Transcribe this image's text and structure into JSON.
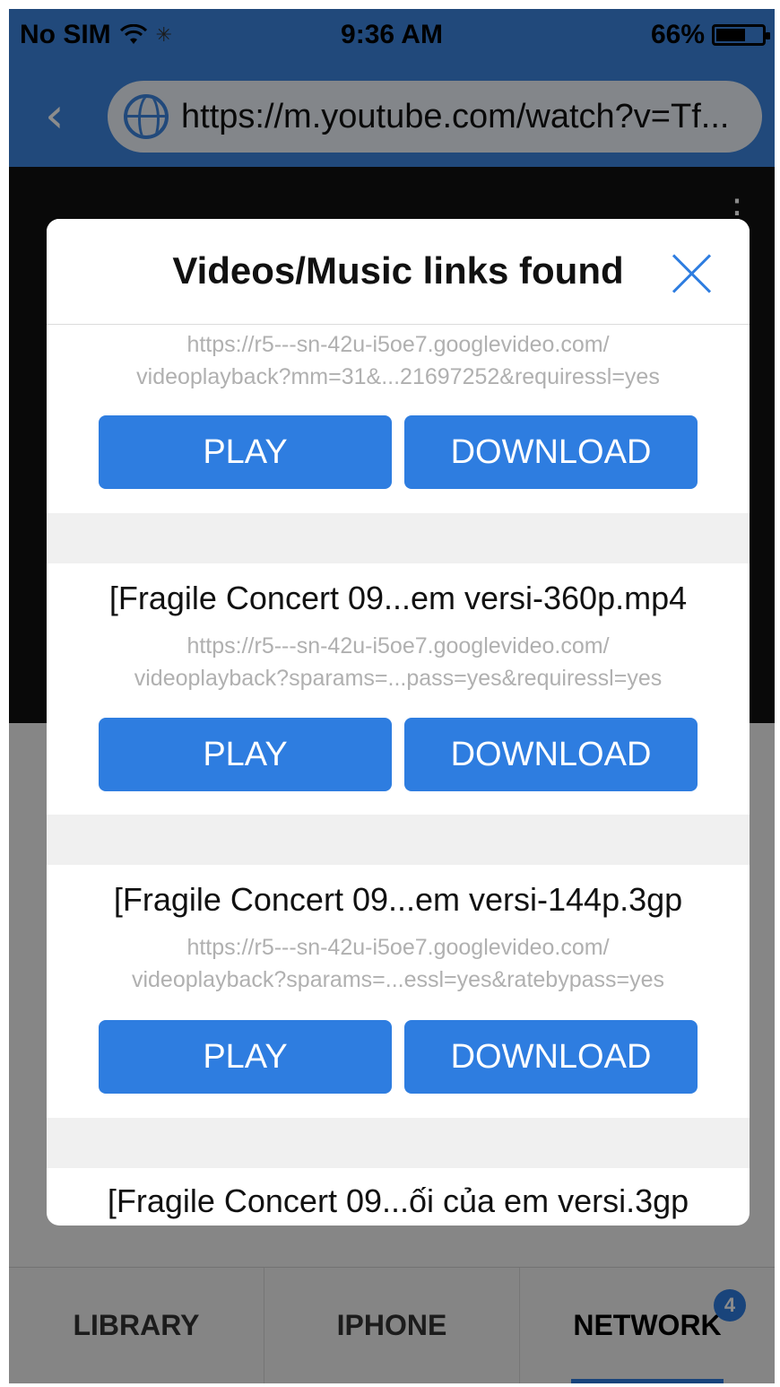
{
  "status_bar": {
    "carrier": "No SIM",
    "time": "9:36 AM",
    "battery": "66%",
    "battery_level": 0.66
  },
  "browser": {
    "url": "https://m.youtube.com/watch?v=Tf..."
  },
  "dialog": {
    "title": "Videos/Music links found",
    "items": [
      {
        "name": "",
        "url_line1": "https://r5---sn-42u-i5oe7.googlevideo.com/",
        "url_line2": "videoplayback?mm=31&...21697252&requiressl=yes",
        "play_label": "PLAY",
        "download_label": "DOWNLOAD"
      },
      {
        "name": "[Fragile Concert 09...em versi-360p.mp4",
        "url_line1": "https://r5---sn-42u-i5oe7.googlevideo.com/",
        "url_line2": "videoplayback?sparams=...pass=yes&requiressl=yes",
        "play_label": "PLAY",
        "download_label": "DOWNLOAD"
      },
      {
        "name": "[Fragile Concert 09...em versi-144p.3gp",
        "url_line1": "https://r5---sn-42u-i5oe7.googlevideo.com/",
        "url_line2": "videoplayback?sparams=...essl=yes&ratebypass=yes",
        "play_label": "PLAY",
        "download_label": "DOWNLOAD"
      },
      {
        "name": "[Fragile Concert 09...ối của em versi.3gp"
      }
    ]
  },
  "tab_bar": {
    "tabs": [
      {
        "label": "LIBRARY"
      },
      {
        "label": "IPHONE"
      },
      {
        "label": "NETWORK",
        "badge": "4"
      }
    ]
  },
  "colors": {
    "accent": "#2e7de0",
    "navbar": "#3c86e0"
  }
}
